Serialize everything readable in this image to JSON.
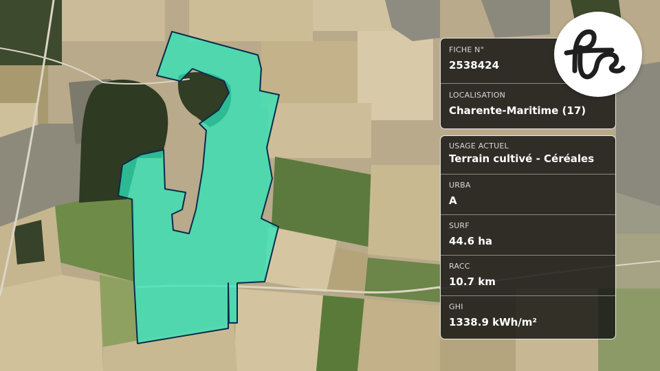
{
  "map": {
    "colors": {
      "base": "#b7a98c",
      "parcel_fill": "#2ee6b8",
      "parcel_stroke": "#0b2a4a",
      "forest": "#2f3a22",
      "field_light": "#d6c6a3",
      "field_green": "#5f7a3e"
    }
  },
  "info_top": {
    "fiche_label": "FICHE N°",
    "fiche_value": "2538424",
    "localisation_label": "LOCALISATION",
    "localisation_value": "Charente-Maritime (17)"
  },
  "info_bottom": {
    "usage_label": "USAGE ACTUEL",
    "usage_value": "Terrain cultivé - Céréales",
    "urba_label": "URBA",
    "urba_value": "A",
    "surf_label": "SURF",
    "surf_value": "44.6 ha",
    "racc_label": "RACC",
    "racc_value": "10.7 km",
    "ghi_label": "GHI",
    "ghi_value": "1338.9 kWh/m²"
  },
  "logo": {
    "icon": "fs-monogram-icon"
  }
}
